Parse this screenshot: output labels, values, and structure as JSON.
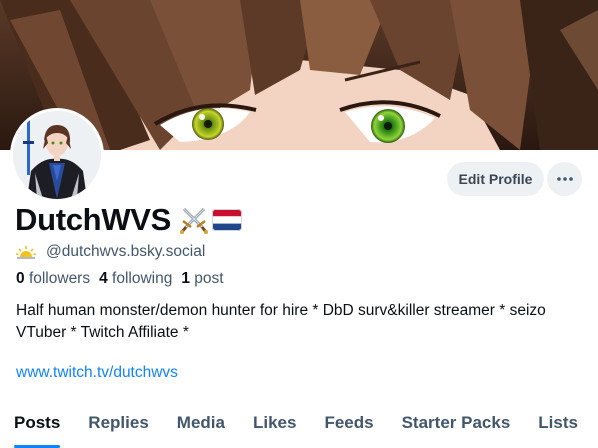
{
  "profile": {
    "display_name": "DutchWVS",
    "handle": "@dutchwvs.bsky.social",
    "followers_count": "0",
    "followers_label": "followers",
    "following_count": "4",
    "following_label": "following",
    "posts_count": "1",
    "posts_label": "post",
    "bio": "Half human monster/demon hunter for hire * DbD surv&killer streamer * seizo VTuber * Twitch Affiliate *",
    "link": "www.twitch.tv/dutchwvs"
  },
  "actions": {
    "edit_profile": "Edit Profile",
    "more": "more-dots-icon"
  },
  "icons": {
    "name_decorations": [
      "crossed-swords-icon",
      "netherlands-flag-icon"
    ],
    "handle_decoration": "sunrise-icon"
  },
  "tabs": [
    {
      "label": "Posts",
      "active": true
    },
    {
      "label": "Replies",
      "active": false
    },
    {
      "label": "Media",
      "active": false
    },
    {
      "label": "Likes",
      "active": false
    },
    {
      "label": "Feeds",
      "active": false
    },
    {
      "label": "Starter Packs",
      "active": false
    },
    {
      "label": "Lists",
      "active": false
    }
  ],
  "colors": {
    "accent": "#1083fe",
    "text": "#0b0f14",
    "muted": "#42576c",
    "button_bg": "#eef1f4"
  }
}
